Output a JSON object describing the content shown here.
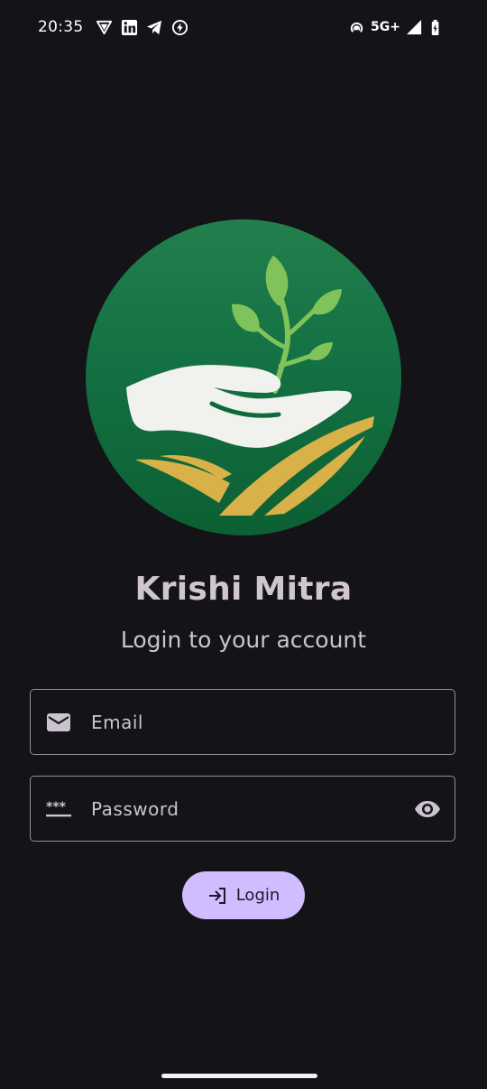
{
  "status_bar": {
    "time": "20:35",
    "network": "5G+",
    "left_icons": [
      "vpn-shield-icon",
      "linkedin-icon",
      "telegram-icon",
      "battery-saver-icon"
    ],
    "right_icons": [
      "hotspot-icon",
      "signal-icon",
      "battery-charging-icon"
    ]
  },
  "app": {
    "title": "Krishi Mitra",
    "subtitle": "Login to your account",
    "logo_icon": "hand-sprout-field-logo"
  },
  "form": {
    "email": {
      "placeholder": "Email",
      "value": "",
      "icon": "mail-icon"
    },
    "password": {
      "placeholder": "Password",
      "value": "",
      "icon": "password-icon",
      "toggle_icon": "eye-icon"
    },
    "login_button": {
      "label": "Login",
      "icon": "login-arrow-icon"
    }
  },
  "colors": {
    "background": "#141318",
    "logo_green": "#1b7a44",
    "leaf_green": "#7fc35a",
    "field_gold": "#d8b248",
    "hand": "#f1f2ee",
    "title": "#cfc6cf",
    "button": "#d0bcff",
    "outline": "#938f99"
  }
}
